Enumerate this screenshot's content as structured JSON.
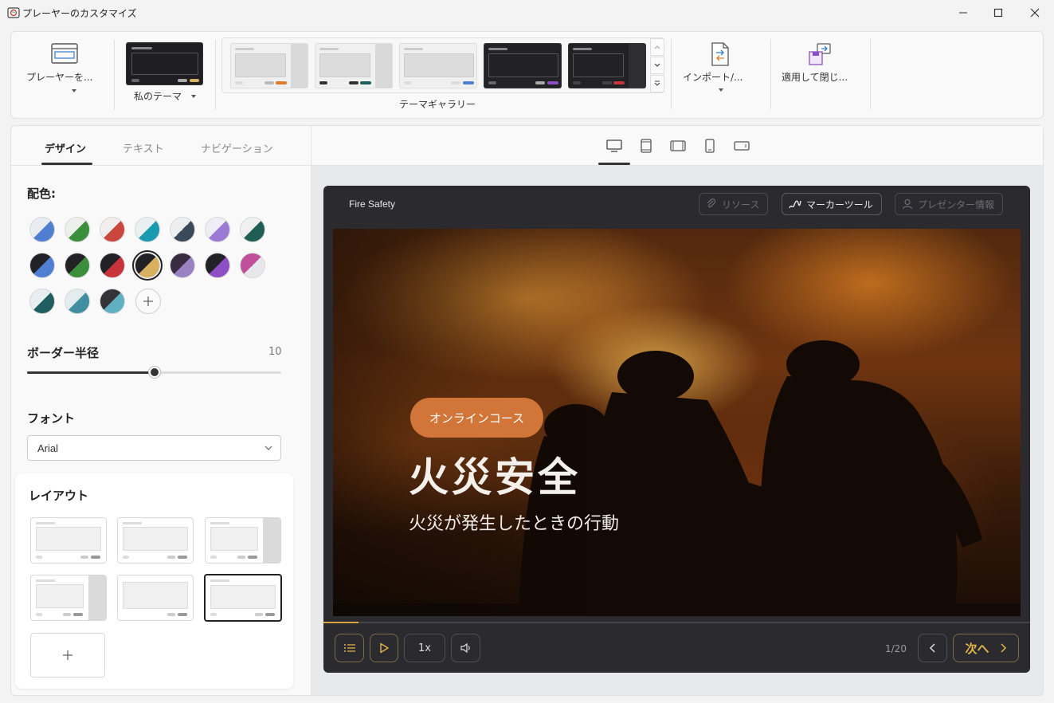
{
  "window": {
    "title": "プレーヤーのカスタマイズ"
  },
  "ribbon": {
    "player_button": "プレーヤーを...",
    "my_theme_label": "私のテーマ",
    "gallery_label": "テーマギャラリー",
    "import_label": "インポート/...",
    "apply_label": "適用して閉じ..."
  },
  "tabs": [
    {
      "label": "デザイン",
      "active": true
    },
    {
      "label": "テキスト",
      "active": false
    },
    {
      "label": "ナビゲーション",
      "active": false
    }
  ],
  "design": {
    "colors_title": "配色:",
    "swatches": [
      {
        "a": "#e9ecf2",
        "b": "#4f7fd0"
      },
      {
        "a": "#eef0ec",
        "b": "#3b8f3b"
      },
      {
        "a": "#f2eeee",
        "b": "#c9473c"
      },
      {
        "a": "#eaf0f2",
        "b": "#1a9ab0"
      },
      {
        "a": "#eceef0",
        "b": "#3b4a5a"
      },
      {
        "a": "#efedf5",
        "b": "#9b7ad6"
      },
      {
        "a": "#eef1f0",
        "b": "#1f5e55"
      },
      {
        "a": "#222226",
        "b": "#4f7fd0"
      },
      {
        "a": "#222226",
        "b": "#3b8f3b"
      },
      {
        "a": "#222226",
        "b": "#c9333c"
      },
      {
        "a": "#222226",
        "b": "#d8b060",
        "selected": true
      },
      {
        "a": "#3a2c40",
        "b": "#9a82c2"
      },
      {
        "a": "#222226",
        "b": "#8f4fc4"
      },
      {
        "a": "#c0509a",
        "b": "#e8e8ec"
      },
      {
        "a": "#e8eef0",
        "b": "#1e5e60"
      },
      {
        "a": "#e4ecef",
        "b": "#3f8fa0"
      },
      {
        "a": "#333338",
        "b": "#5fb0c0"
      }
    ],
    "radius_title": "ボーダー半径",
    "radius_value": "10",
    "radius_fraction": 0.5,
    "font_title": "フォント",
    "font_value": "Arial",
    "layout_title": "レイアウト"
  },
  "player": {
    "course_title": "Fire Safety",
    "resources_label": "リソース",
    "marker_label": "マーカーツール",
    "presenter_label": "プレゼンター情報",
    "badge": "オンラインコース",
    "slide_title": "火災安全",
    "slide_subtitle": "火災が発生したときの行動",
    "progress_fraction": 0.05,
    "speed_label": "1x",
    "page_count": "1/20",
    "next_label": "次へ"
  }
}
